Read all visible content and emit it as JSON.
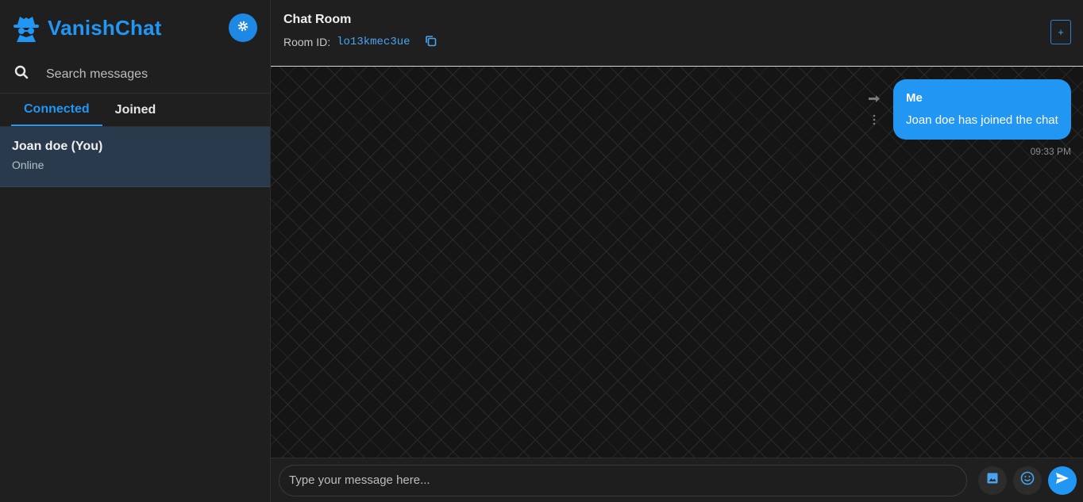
{
  "brand": {
    "name": "VanishChat",
    "icon": "spy-incognito-icon",
    "accent": "#2196f3"
  },
  "search": {
    "placeholder": "Search messages"
  },
  "tabs": [
    {
      "label": "Connected",
      "active": true
    },
    {
      "label": "Joined",
      "active": false
    }
  ],
  "users": [
    {
      "name": "Joan doe (You)",
      "status": "Online"
    }
  ],
  "header": {
    "title": "Chat Room",
    "room_id_label": "Room ID:",
    "room_id": "lo13kmec3ue",
    "new_button": "+"
  },
  "messages": [
    {
      "sender": "Me",
      "text": "Joan doe has joined the chat",
      "time": "09:33 PM",
      "outgoing": true
    }
  ],
  "composer": {
    "placeholder": "Type your message here..."
  }
}
